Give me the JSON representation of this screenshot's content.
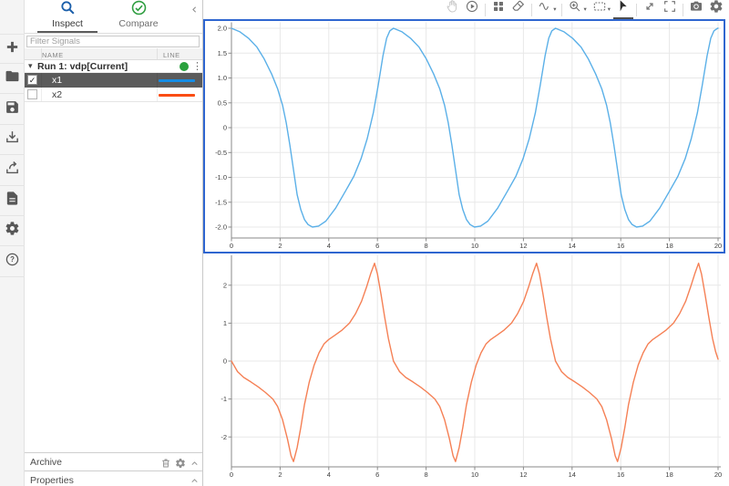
{
  "left_toolbar": {
    "items": [
      "add-icon",
      "open-folder-icon",
      "save-icon",
      "import-icon",
      "export-icon",
      "report-icon",
      "preferences-icon",
      "help-icon"
    ]
  },
  "sidebar": {
    "collapse_icon": "chevron-left-icon",
    "tabs": [
      {
        "label": "Inspect",
        "icon": "search-icon",
        "icon_color": "#1b5faa",
        "active": true
      },
      {
        "label": "Compare",
        "icon": "check-circle-icon",
        "icon_color": "#2f9e41",
        "active": false
      }
    ],
    "filter": {
      "placeholder": "Filter Signals"
    },
    "signal_table": {
      "columns": [
        "NAME",
        "LINE"
      ],
      "run": {
        "label": "Run 1: vdp[Current]",
        "status_dot_color": "#2aa13d"
      },
      "signals": [
        {
          "name": "x1",
          "checked": true,
          "selected": true,
          "swatch_color": "#158ce4"
        },
        {
          "name": "x2",
          "checked": false,
          "selected": false,
          "swatch_color": "#fa4d14"
        }
      ]
    },
    "archive": {
      "label": "Archive"
    },
    "properties": {
      "label": "Properties"
    }
  },
  "ui_glyphs": {
    "caret_down": "▾",
    "kebab": "⋮",
    "check": "✓"
  },
  "plot_toolbar": {
    "groups": [
      {
        "buttons": [
          {
            "icon": "pan-icon",
            "disabled": true
          },
          {
            "icon": "replay-icon"
          }
        ]
      },
      {
        "buttons": [
          {
            "icon": "layout-grid-icon"
          },
          {
            "icon": "eraser-icon"
          }
        ]
      },
      {
        "buttons": [
          {
            "icon": "signal-wave-icon",
            "caret": true
          }
        ]
      },
      {
        "buttons": [
          {
            "icon": "zoom-in-icon",
            "caret": true
          },
          {
            "icon": "fit-to-view-icon",
            "caret": true
          },
          {
            "icon": "cursor-arrow-icon",
            "active": true
          }
        ]
      },
      {
        "buttons": [
          {
            "icon": "expand-diagonal-icon"
          },
          {
            "icon": "fullscreen-icon"
          }
        ]
      },
      {
        "buttons": [
          {
            "icon": "camera-icon"
          },
          {
            "icon": "plot-settings-icon"
          }
        ]
      }
    ]
  },
  "chart_data": [
    {
      "type": "line",
      "signal": "x1",
      "line_color": "#5bb0e8",
      "selected": true,
      "selection_color": "#2f66d0",
      "grid": true,
      "xlim": [
        0,
        20
      ],
      "ylim": [
        -2.22,
        2.12
      ],
      "xticks": [
        0,
        2,
        4,
        6,
        8,
        10,
        12,
        14,
        16,
        18,
        20
      ],
      "yticks": [
        2,
        1.5,
        1,
        0.5,
        0,
        -0.5,
        -1,
        -1.5,
        -2
      ],
      "ytick_labels": [
        "2.0",
        "1.5",
        "1.0",
        "0.5",
        "0",
        "-0.5",
        "-1.0",
        "-1.5",
        "-2.0"
      ],
      "points": [
        [
          0,
          2
        ],
        [
          0.35,
          1.93
        ],
        [
          0.7,
          1.8
        ],
        [
          1.05,
          1.62
        ],
        [
          1.35,
          1.38
        ],
        [
          1.65,
          1.08
        ],
        [
          1.9,
          0.78
        ],
        [
          2.1,
          0.45
        ],
        [
          2.25,
          0.1
        ],
        [
          2.4,
          -0.35
        ],
        [
          2.55,
          -0.85
        ],
        [
          2.7,
          -1.35
        ],
        [
          2.85,
          -1.65
        ],
        [
          3,
          -1.85
        ],
        [
          3.15,
          -1.95
        ],
        [
          3.33,
          -2
        ],
        [
          3.58,
          -1.98
        ],
        [
          3.88,
          -1.88
        ],
        [
          4.28,
          -1.62
        ],
        [
          4.68,
          -1.28
        ],
        [
          5.03,
          -0.98
        ],
        [
          5.33,
          -0.62
        ],
        [
          5.58,
          -0.22
        ],
        [
          5.83,
          0.3
        ],
        [
          6.03,
          0.85
        ],
        [
          6.23,
          1.45
        ],
        [
          6.38,
          1.8
        ],
        [
          6.51,
          1.95
        ],
        [
          6.66,
          2
        ],
        [
          7.01,
          1.93
        ],
        [
          7.36,
          1.8
        ],
        [
          7.71,
          1.62
        ],
        [
          8.01,
          1.38
        ],
        [
          8.31,
          1.08
        ],
        [
          8.56,
          0.78
        ],
        [
          8.76,
          0.45
        ],
        [
          8.91,
          0.1
        ],
        [
          9.06,
          -0.35
        ],
        [
          9.21,
          -0.85
        ],
        [
          9.36,
          -1.35
        ],
        [
          9.51,
          -1.65
        ],
        [
          9.66,
          -1.85
        ],
        [
          9.81,
          -1.95
        ],
        [
          9.99,
          -2
        ],
        [
          10.24,
          -1.98
        ],
        [
          10.54,
          -1.88
        ],
        [
          10.94,
          -1.62
        ],
        [
          11.34,
          -1.28
        ],
        [
          11.69,
          -0.98
        ],
        [
          11.99,
          -0.62
        ],
        [
          12.24,
          -0.22
        ],
        [
          12.49,
          0.3
        ],
        [
          12.69,
          0.85
        ],
        [
          12.89,
          1.45
        ],
        [
          13.04,
          1.8
        ],
        [
          13.17,
          1.95
        ],
        [
          13.32,
          2
        ],
        [
          13.67,
          1.93
        ],
        [
          14.02,
          1.8
        ],
        [
          14.37,
          1.62
        ],
        [
          14.67,
          1.38
        ],
        [
          14.97,
          1.08
        ],
        [
          15.22,
          0.78
        ],
        [
          15.42,
          0.45
        ],
        [
          15.57,
          0.1
        ],
        [
          15.72,
          -0.35
        ],
        [
          15.87,
          -0.85
        ],
        [
          16.02,
          -1.35
        ],
        [
          16.17,
          -1.65
        ],
        [
          16.32,
          -1.85
        ],
        [
          16.47,
          -1.95
        ],
        [
          16.65,
          -2
        ],
        [
          16.9,
          -1.98
        ],
        [
          17.2,
          -1.88
        ],
        [
          17.6,
          -1.62
        ],
        [
          18,
          -1.28
        ],
        [
          18.35,
          -0.98
        ],
        [
          18.65,
          -0.62
        ],
        [
          18.9,
          -0.22
        ],
        [
          19.15,
          0.3
        ],
        [
          19.35,
          0.85
        ],
        [
          19.55,
          1.45
        ],
        [
          19.7,
          1.8
        ],
        [
          19.83,
          1.95
        ],
        [
          19.98,
          2
        ],
        [
          20,
          2
        ]
      ]
    },
    {
      "type": "line",
      "signal": "x2",
      "line_color": "#f58055",
      "selected": false,
      "grid": true,
      "xlim": [
        0,
        20
      ],
      "ylim": [
        -2.79,
        2.79
      ],
      "xticks": [
        0,
        2,
        4,
        6,
        8,
        10,
        12,
        14,
        16,
        18,
        20
      ],
      "yticks": [
        2,
        1,
        0,
        -1,
        -2
      ],
      "ytick_labels": [
        "2",
        "1",
        "0",
        "-1",
        "-2"
      ],
      "points": [
        [
          0,
          0
        ],
        [
          0.25,
          -0.28
        ],
        [
          0.5,
          -0.43
        ],
        [
          0.8,
          -0.55
        ],
        [
          1.1,
          -0.68
        ],
        [
          1.4,
          -0.83
        ],
        [
          1.7,
          -1
        ],
        [
          1.9,
          -1.2
        ],
        [
          2.1,
          -1.55
        ],
        [
          2.3,
          -2.05
        ],
        [
          2.45,
          -2.5
        ],
        [
          2.55,
          -2.65
        ],
        [
          2.7,
          -2.28
        ],
        [
          2.85,
          -1.75
        ],
        [
          3,
          -1.15
        ],
        [
          3.2,
          -0.55
        ],
        [
          3.4,
          -0.1
        ],
        [
          3.6,
          0.22
        ],
        [
          3.8,
          0.45
        ],
        [
          4,
          0.57
        ],
        [
          4.25,
          0.68
        ],
        [
          4.55,
          0.82
        ],
        [
          4.85,
          1
        ],
        [
          5.1,
          1.25
        ],
        [
          5.35,
          1.58
        ],
        [
          5.55,
          1.95
        ],
        [
          5.72,
          2.3
        ],
        [
          5.88,
          2.58
        ],
        [
          6,
          2.3
        ],
        [
          6.15,
          1.75
        ],
        [
          6.3,
          1.15
        ],
        [
          6.45,
          0.6
        ],
        [
          6.58,
          0.22
        ],
        [
          6.66,
          0
        ],
        [
          6.91,
          -0.28
        ],
        [
          7.16,
          -0.43
        ],
        [
          7.46,
          -0.55
        ],
        [
          7.76,
          -0.68
        ],
        [
          8.06,
          -0.83
        ],
        [
          8.36,
          -1
        ],
        [
          8.56,
          -1.2
        ],
        [
          8.76,
          -1.55
        ],
        [
          8.96,
          -2.05
        ],
        [
          9.11,
          -2.5
        ],
        [
          9.21,
          -2.65
        ],
        [
          9.36,
          -2.28
        ],
        [
          9.51,
          -1.75
        ],
        [
          9.66,
          -1.15
        ],
        [
          9.86,
          -0.55
        ],
        [
          10.06,
          -0.1
        ],
        [
          10.26,
          0.22
        ],
        [
          10.46,
          0.45
        ],
        [
          10.66,
          0.57
        ],
        [
          10.91,
          0.68
        ],
        [
          11.21,
          0.82
        ],
        [
          11.51,
          1
        ],
        [
          11.76,
          1.25
        ],
        [
          12.01,
          1.58
        ],
        [
          12.21,
          1.95
        ],
        [
          12.38,
          2.3
        ],
        [
          12.54,
          2.58
        ],
        [
          12.66,
          2.3
        ],
        [
          12.81,
          1.75
        ],
        [
          12.96,
          1.15
        ],
        [
          13.11,
          0.6
        ],
        [
          13.24,
          0.22
        ],
        [
          13.32,
          0
        ],
        [
          13.57,
          -0.28
        ],
        [
          13.82,
          -0.43
        ],
        [
          14.12,
          -0.55
        ],
        [
          14.42,
          -0.68
        ],
        [
          14.72,
          -0.83
        ],
        [
          15.02,
          -1
        ],
        [
          15.22,
          -1.2
        ],
        [
          15.42,
          -1.55
        ],
        [
          15.62,
          -2.05
        ],
        [
          15.77,
          -2.5
        ],
        [
          15.87,
          -2.65
        ],
        [
          16.02,
          -2.28
        ],
        [
          16.17,
          -1.75
        ],
        [
          16.32,
          -1.15
        ],
        [
          16.52,
          -0.55
        ],
        [
          16.72,
          -0.1
        ],
        [
          16.92,
          0.22
        ],
        [
          17.12,
          0.45
        ],
        [
          17.32,
          0.57
        ],
        [
          17.57,
          0.68
        ],
        [
          17.87,
          0.82
        ],
        [
          18.17,
          1
        ],
        [
          18.42,
          1.25
        ],
        [
          18.67,
          1.58
        ],
        [
          18.87,
          1.95
        ],
        [
          19.04,
          2.3
        ],
        [
          19.2,
          2.58
        ],
        [
          19.32,
          2.3
        ],
        [
          19.47,
          1.75
        ],
        [
          19.62,
          1.15
        ],
        [
          19.77,
          0.6
        ],
        [
          19.9,
          0.25
        ],
        [
          20,
          0.05
        ]
      ]
    }
  ]
}
